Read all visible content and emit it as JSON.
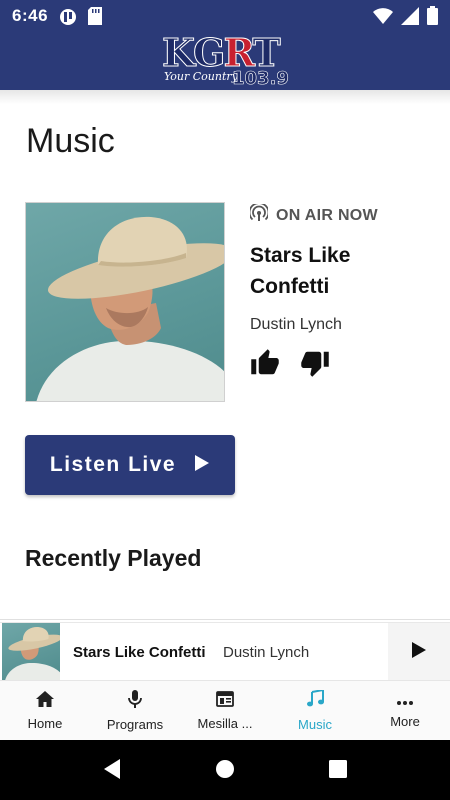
{
  "status_bar": {
    "time": "6:46",
    "icons": [
      "record-icon",
      "sd-card-icon",
      "wifi-icon",
      "signal-icon",
      "battery-icon"
    ]
  },
  "header": {
    "logo_text": "KGRT",
    "logo_tagline": "Your Country",
    "logo_frequency": "103.9",
    "background": "#2b3a78"
  },
  "page": {
    "title": "Music"
  },
  "now_playing": {
    "on_air_label": "ON AIR NOW",
    "song": "Stars Like Confetti",
    "artist": "Dustin Lynch",
    "thumbs": [
      "thumbs-up-icon",
      "thumbs-down-icon"
    ]
  },
  "listen_live": {
    "label": "Listen Live"
  },
  "recently_played": {
    "heading": "Recently Played"
  },
  "mini_player": {
    "song": "Stars Like Confetti",
    "artist": "Dustin Lynch"
  },
  "bottom_nav": {
    "items": [
      {
        "label": "Home",
        "icon": "home-icon",
        "active": false
      },
      {
        "label": "Programs",
        "icon": "microphone-icon",
        "active": false
      },
      {
        "label": "Mesilla ...",
        "icon": "newspaper-icon",
        "active": false
      },
      {
        "label": "Music",
        "icon": "music-note-icon",
        "active": true
      },
      {
        "label": "More",
        "icon": "more-dots-icon",
        "active": false
      }
    ],
    "active_color": "#2aa7c8"
  },
  "system_nav": {
    "buttons": [
      "back-icon",
      "home-circle-icon",
      "recents-icon"
    ]
  },
  "colors": {
    "brand_navy": "#2b3a78",
    "accent_cyan": "#2aa7c8"
  }
}
